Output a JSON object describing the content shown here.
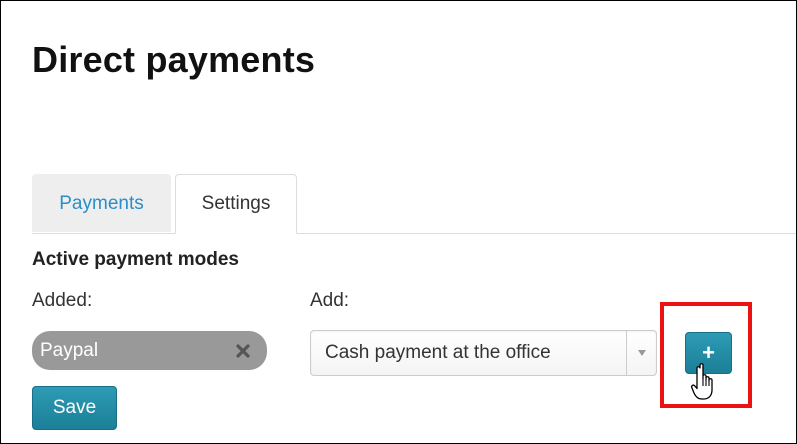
{
  "page": {
    "title": "Direct payments"
  },
  "tabs": [
    {
      "label": "Payments",
      "active": false
    },
    {
      "label": "Settings",
      "active": true
    }
  ],
  "settings": {
    "section_heading": "Active payment modes",
    "added_label": "Added:",
    "add_label": "Add:",
    "added_modes": [
      {
        "label": "Paypal",
        "remove_icon": "close-icon"
      }
    ],
    "add_select": {
      "selected_value": "Cash payment at the office",
      "caret_icon": "caret-down-icon"
    },
    "add_button": {
      "label": "+",
      "icon": "plus-icon"
    },
    "save_label": "Save"
  },
  "annotation": {
    "highlight_color": "#ee1111",
    "cursor_icon": "hand-pointer-icon"
  },
  "colors": {
    "accent": "#1f87a0",
    "link": "#2a8ec8",
    "tag_background": "#999999"
  }
}
